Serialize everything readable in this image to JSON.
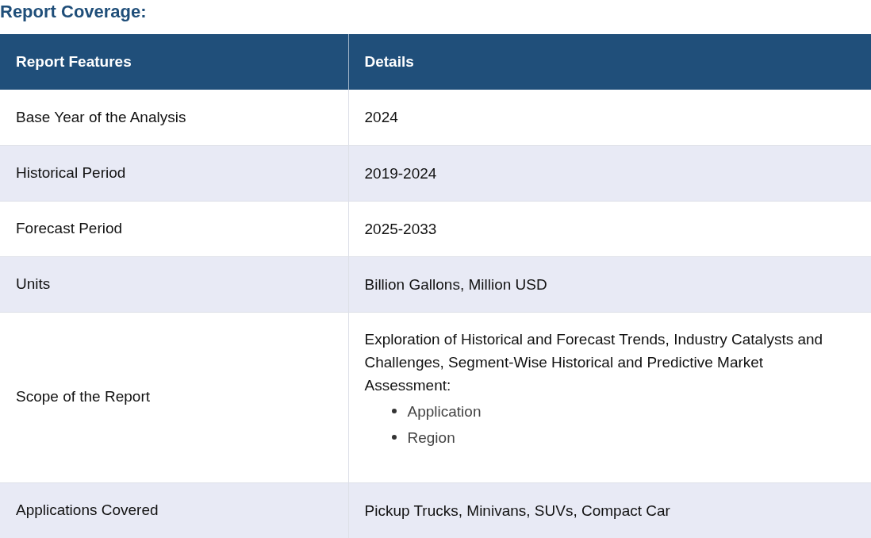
{
  "title": "Report Coverage:",
  "table": {
    "columns": [
      "Report Features",
      "Details"
    ],
    "rows": [
      {
        "feature": "Base Year of the Analysis",
        "details": "2024"
      },
      {
        "feature": "Historical Period",
        "details": "2019-2024"
      },
      {
        "feature": "Forecast Period",
        "details": "2025-2033"
      },
      {
        "feature": "Units",
        "details": "Billion Gallons, Million USD"
      },
      {
        "feature": "Scope of the Report",
        "details": "Exploration of Historical and Forecast Trends, Industry Catalysts and Challenges, Segment-Wise Historical and Predictive Market Assessment:",
        "list": [
          "Application",
          "Region"
        ]
      },
      {
        "feature": "Applications Covered",
        "details": "Pickup Trucks, Minivans, SUVs, Compact Car"
      }
    ]
  }
}
